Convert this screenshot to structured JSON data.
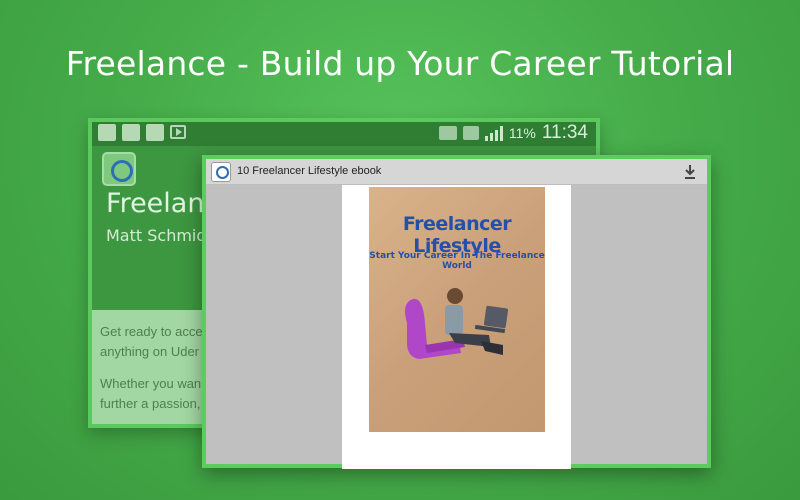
{
  "banner": {
    "title": "Freelance - Build up Your Career Tutorial"
  },
  "status_bar": {
    "battery": "11%",
    "time": "11:34"
  },
  "app": {
    "title": "Freelanc",
    "author": "Matt Schmidt",
    "body_lines": [
      "Get ready to acce",
      "anything on Uder",
      "Whether you wan",
      "further a passion,"
    ]
  },
  "viewer": {
    "title": "10  Freelancer Lifestyle ebook",
    "download_icon": "download-icon"
  },
  "cover": {
    "title": "Freelancer Lifestyle",
    "subtitle": "Start Your Career In The Freelance World"
  },
  "colors": {
    "background": "#46ad4a",
    "frame": "#5ccc5f",
    "cover_text": "#2450a8"
  }
}
